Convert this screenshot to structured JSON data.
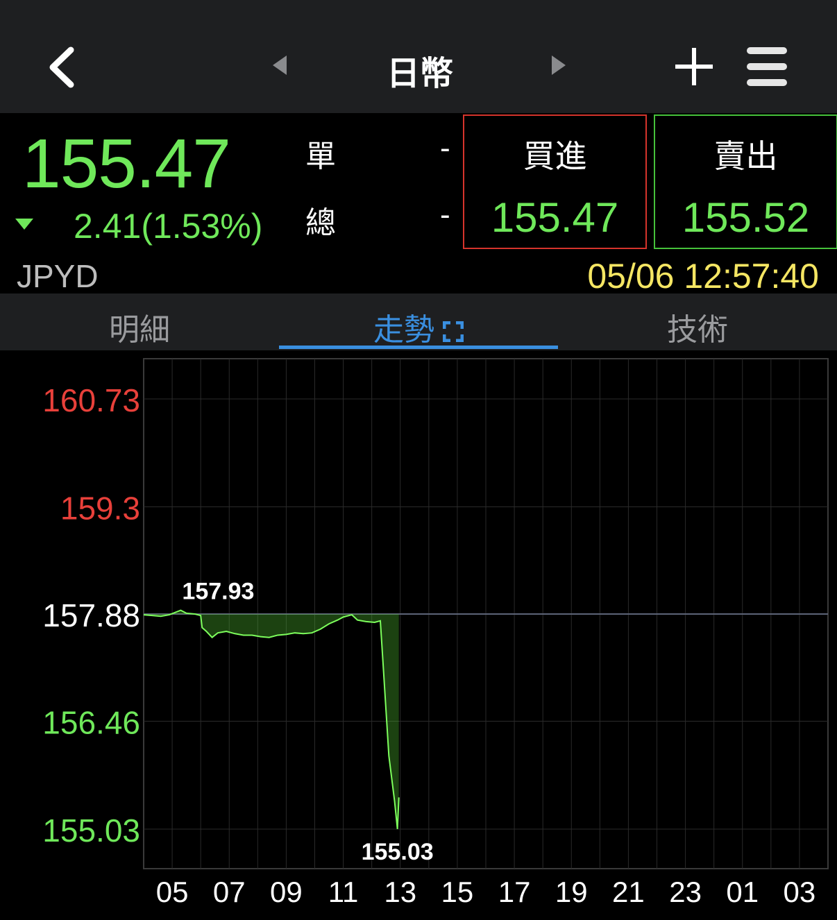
{
  "header": {
    "title": "日幣",
    "back_icon": "chevron-left-icon",
    "prev_icon": "triangle-left-icon",
    "next_icon": "triangle-right-icon",
    "add_icon": "plus-icon",
    "menu_icon": "menu-icon"
  },
  "quote": {
    "price": "155.47",
    "change": "2.41",
    "change_pct": "(1.53%)",
    "direction": "down",
    "single_label": "單",
    "single_value": "-",
    "total_label": "總",
    "total_value": "-",
    "buy_label": "買進",
    "buy_value": "155.47",
    "sell_label": "賣出",
    "sell_value": "155.52",
    "code": "JPYD",
    "timestamp": "05/06 12:57:40"
  },
  "tabs": {
    "detail": "明細",
    "trend": "走勢",
    "technical": "技術",
    "active": "trend"
  },
  "colors": {
    "up": "#e8403a",
    "down": "#6fe85a",
    "neutral": "#ffffff",
    "accent": "#3a8fe0",
    "timestamp": "#f5e663"
  },
  "chart_data": {
    "type": "area",
    "reference": 157.88,
    "ylim": [
      155.03,
      160.73
    ],
    "y_ticks": [
      {
        "value": 160.73,
        "label": "160.73",
        "tone": "up"
      },
      {
        "value": 159.3,
        "label": "159.3",
        "tone": "up"
      },
      {
        "value": 157.88,
        "label": "157.88",
        "tone": "neutral"
      },
      {
        "value": 156.46,
        "label": "156.46",
        "tone": "down"
      },
      {
        "value": 155.03,
        "label": "155.03",
        "tone": "down"
      }
    ],
    "x_labels": [
      "05",
      "07",
      "09",
      "11",
      "13",
      "15",
      "17",
      "19",
      "21",
      "23",
      "01",
      "03"
    ],
    "x_start_hour": 4,
    "x_span_hours": 24,
    "high": {
      "label": "157.93",
      "value": 157.93,
      "hour": 5.3
    },
    "low": {
      "label": "155.03",
      "value": 155.03,
      "hour": 12.9
    },
    "series": [
      {
        "x": 4.0,
        "y": 157.87
      },
      {
        "x": 4.3,
        "y": 157.86
      },
      {
        "x": 4.6,
        "y": 157.85
      },
      {
        "x": 4.9,
        "y": 157.87
      },
      {
        "x": 5.1,
        "y": 157.9
      },
      {
        "x": 5.3,
        "y": 157.93
      },
      {
        "x": 5.5,
        "y": 157.89
      },
      {
        "x": 5.8,
        "y": 157.88
      },
      {
        "x": 6.0,
        "y": 157.86
      },
      {
        "x": 6.05,
        "y": 157.7
      },
      {
        "x": 6.2,
        "y": 157.65
      },
      {
        "x": 6.4,
        "y": 157.57
      },
      {
        "x": 6.6,
        "y": 157.63
      },
      {
        "x": 6.9,
        "y": 157.65
      },
      {
        "x": 7.2,
        "y": 157.62
      },
      {
        "x": 7.5,
        "y": 157.6
      },
      {
        "x": 7.8,
        "y": 157.6
      },
      {
        "x": 8.1,
        "y": 157.58
      },
      {
        "x": 8.4,
        "y": 157.57
      },
      {
        "x": 8.7,
        "y": 157.6
      },
      {
        "x": 9.0,
        "y": 157.61
      },
      {
        "x": 9.3,
        "y": 157.63
      },
      {
        "x": 9.6,
        "y": 157.62
      },
      {
        "x": 9.9,
        "y": 157.63
      },
      {
        "x": 10.2,
        "y": 157.68
      },
      {
        "x": 10.5,
        "y": 157.75
      },
      {
        "x": 10.8,
        "y": 157.8
      },
      {
        "x": 11.0,
        "y": 157.84
      },
      {
        "x": 11.3,
        "y": 157.87
      },
      {
        "x": 11.5,
        "y": 157.8
      },
      {
        "x": 11.8,
        "y": 157.78
      },
      {
        "x": 12.1,
        "y": 157.77
      },
      {
        "x": 12.3,
        "y": 157.79
      },
      {
        "x": 12.4,
        "y": 157.2
      },
      {
        "x": 12.5,
        "y": 156.6
      },
      {
        "x": 12.6,
        "y": 156.0
      },
      {
        "x": 12.7,
        "y": 155.7
      },
      {
        "x": 12.8,
        "y": 155.4
      },
      {
        "x": 12.9,
        "y": 155.03
      },
      {
        "x": 12.95,
        "y": 155.45
      }
    ]
  }
}
